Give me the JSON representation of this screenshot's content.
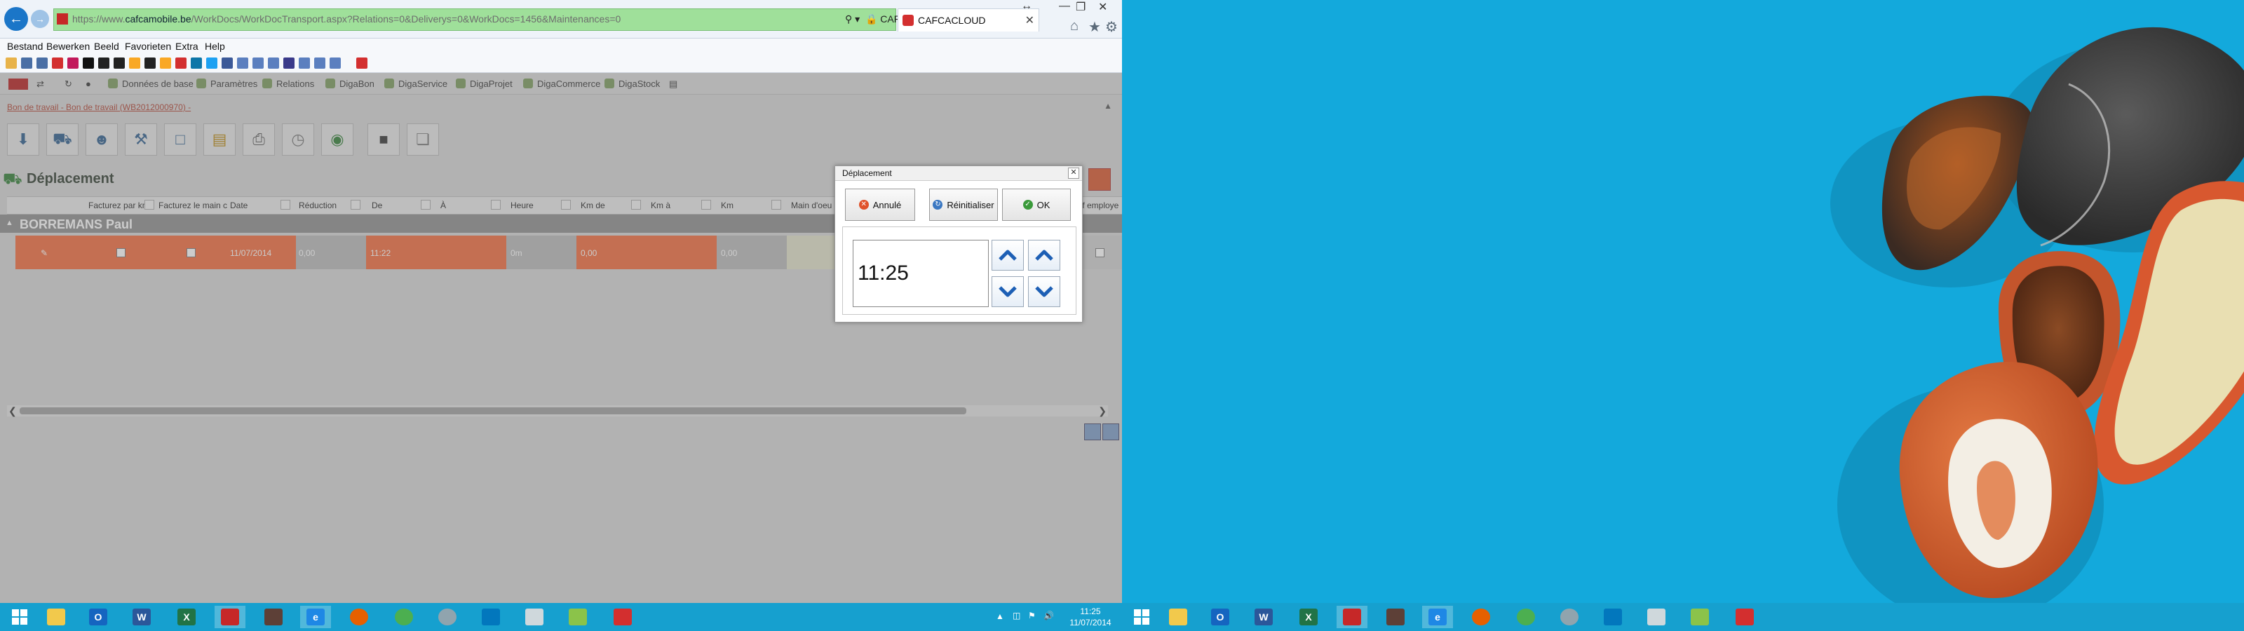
{
  "browser": {
    "url_prefix": "https://www.",
    "url_domain": "cafcamobile.be",
    "url_path": "/WorkDocs/WorkDocTransport.aspx?Relations=0&Deliverys=0&WorkDocs=1456&Maintenances=0",
    "site_identity": "CAFCA [BE]",
    "tab_title": "CAFCACLOUD",
    "menu": [
      "Bestand",
      "Bewerken",
      "Beeld",
      "Favorieten",
      "Extra",
      "Help"
    ]
  },
  "app": {
    "nav": [
      "Données de base",
      "Paramètres",
      "Relations",
      "DigaBon",
      "DigaService",
      "DigaProjet",
      "DigaCommerce",
      "DigaStock"
    ],
    "breadcrumb": "Bon de travail - Bon de travail (WB2012000970) -",
    "section_title": "Déplacement",
    "columns": [
      "Facturez par km",
      "Facturez le main c",
      "Date",
      "Réduction",
      "De",
      "À",
      "Heure",
      "Km de",
      "Km à",
      "Km",
      "Main d'oeu",
      "If employe"
    ],
    "group_name": "BORREMANS Paul",
    "row": {
      "date": "11/07/2014",
      "reduction": "0,00",
      "from": "11:22",
      "hour": "0m",
      "km_from": "0,00",
      "km_to": "0,00"
    }
  },
  "dialog": {
    "title": "Déplacement",
    "cancel_label": "Annulé",
    "reset_label": "Réinitialiser",
    "ok_label": "OK",
    "time_value": "11:25"
  },
  "taskbar": {
    "clock_time": "11:25",
    "clock_date": "11/07/2014",
    "apps": [
      "start-icon",
      "file-explorer-icon",
      "outlook-icon",
      "word-icon",
      "excel-icon",
      "cafca-icon",
      "tool-icon",
      "internet-explorer-icon",
      "firefox-icon",
      "chrome-icon",
      "remote-icon",
      "network-icon",
      "notes-icon",
      "photo-viewer-icon",
      "cafca-cloud-icon"
    ]
  },
  "colors": {
    "accent_orange": "#f26a3b",
    "taskbar_blue": "#16a0cf",
    "desktop_blue": "#13a9dc",
    "address_green": "#9fe09a"
  }
}
